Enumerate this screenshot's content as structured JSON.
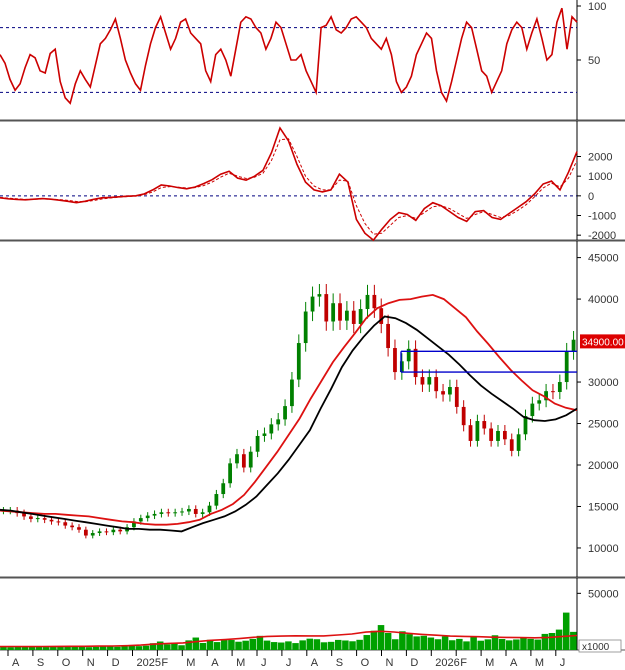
{
  "chart_data": {
    "type": "stock-chart",
    "colors": {
      "up": "#008000",
      "down": "#c00000",
      "indicator": "#cc0000",
      "ma_short": "#000000",
      "ma_long": "#dd1111",
      "box": "#0000cc",
      "guide": "#000080",
      "price_tag": "#dd0000",
      "volume": "#00a000"
    },
    "x_axis": {
      "labels": [
        "A",
        "S",
        "O",
        "N",
        "D",
        "2025",
        "F",
        "M",
        "A",
        "M",
        "J",
        "J",
        "A",
        "S",
        "O",
        "N",
        "D",
        "2026",
        "F",
        "M",
        "A",
        "M",
        "J"
      ]
    },
    "panels": {
      "oscillator": {
        "ylim": [
          0,
          100
        ],
        "ticks": [
          {
            "v": 100,
            "label": "100"
          },
          {
            "v": 50,
            "label": "50"
          }
        ],
        "guide_lines": [
          80,
          20
        ],
        "series": [
          55,
          47,
          32,
          22,
          28,
          43,
          55,
          52,
          40,
          38,
          56,
          60,
          30,
          15,
          10,
          28,
          40,
          32,
          25,
          45,
          65,
          70,
          78,
          88,
          70,
          50,
          38,
          28,
          22,
          45,
          65,
          80,
          90,
          75,
          60,
          70,
          85,
          88,
          75,
          70,
          65,
          40,
          30,
          55,
          60,
          50,
          35,
          60,
          85,
          90,
          88,
          80,
          75,
          60,
          70,
          85,
          80,
          65,
          50,
          50,
          55,
          40,
          30,
          20,
          80,
          82,
          90,
          78,
          75,
          80,
          88,
          90,
          85,
          80,
          70,
          65,
          60,
          70,
          55,
          30,
          20,
          25,
          35,
          55,
          65,
          75,
          70,
          40,
          20,
          12,
          30,
          50,
          70,
          85,
          80,
          60,
          40,
          35,
          20,
          30,
          40,
          65,
          78,
          85,
          80,
          60,
          75,
          88,
          70,
          50,
          55,
          85,
          98,
          60,
          90,
          85
        ]
      },
      "macd": {
        "ylim": [
          -2500,
          3500
        ],
        "ticks": [
          {
            "v": 2000,
            "label": "2000"
          },
          {
            "v": 1000,
            "label": "1000"
          },
          {
            "v": 0,
            "label": "0"
          },
          {
            "v": -1000,
            "label": "-1000"
          },
          {
            "v": -2000,
            "label": "-2000"
          }
        ],
        "zero_line": 0,
        "macd": [
          -100,
          -150,
          -180,
          -200,
          -170,
          -140,
          -170,
          -220,
          -280,
          -350,
          -280,
          -180,
          -100,
          -80,
          -50,
          -20,
          0,
          100,
          300,
          550,
          500,
          420,
          360,
          450,
          620,
          820,
          1100,
          1250,
          900,
          800,
          1000,
          1300,
          2200,
          3450,
          2800,
          1600,
          700,
          300,
          200,
          300,
          1100,
          700,
          -1200,
          -1900,
          -2250,
          -1700,
          -1200,
          -850,
          -950,
          -1250,
          -650,
          -350,
          -500,
          -800,
          -1100,
          -1300,
          -800,
          -750,
          -1100,
          -1200,
          -900,
          -600,
          -300,
          100,
          600,
          750,
          300,
          1200,
          2250
        ],
        "signal": [
          -80,
          -120,
          -150,
          -180,
          -175,
          -160,
          -165,
          -190,
          -230,
          -290,
          -300,
          -240,
          -160,
          -110,
          -70,
          -40,
          -15,
          60,
          200,
          420,
          470,
          440,
          400,
          420,
          520,
          700,
          950,
          1150,
          1000,
          880,
          950,
          1150,
          1800,
          2850,
          2900,
          2000,
          1000,
          500,
          300,
          300,
          800,
          750,
          -500,
          -1400,
          -1950,
          -1900,
          -1500,
          -1100,
          -1000,
          -1150,
          -850,
          -550,
          -500,
          -650,
          -900,
          -1150,
          -950,
          -800,
          -950,
          -1100,
          -1000,
          -750,
          -450,
          -50,
          400,
          650,
          450,
          900,
          1800
        ]
      },
      "price": {
        "ylim": [
          6500,
          47000
        ],
        "ticks": [
          {
            "v": 45000,
            "label": "45000"
          },
          {
            "v": 40000,
            "label": "40000"
          },
          {
            "v": 30000,
            "label": "30000"
          },
          {
            "v": 25000,
            "label": "25000"
          },
          {
            "v": 20000,
            "label": "20000"
          },
          {
            "v": 15000,
            "label": "15000"
          },
          {
            "v": 10000,
            "label": "10000"
          }
        ],
        "last_price_label": "34900.00",
        "last_price": 34900,
        "close": [
          14500,
          14500,
          14200,
          13800,
          13500,
          13600,
          13400,
          13200,
          13100,
          12700,
          12500,
          12200,
          11500,
          11800,
          12000,
          11900,
          12200,
          12000,
          12500,
          13200,
          13600,
          13900,
          14100,
          14300,
          14200,
          14300,
          14400,
          14700,
          14100,
          14300,
          15100,
          16500,
          17800,
          20200,
          21300,
          19700,
          21600,
          23500,
          23800,
          24900,
          25500,
          27100,
          30300,
          34700,
          38500,
          40300,
          40600,
          37300,
          39500,
          37400,
          38600,
          37000,
          38800,
          40500,
          38900,
          37000,
          34100,
          31200,
          32500,
          34000,
          30600,
          29700,
          30600,
          28900,
          28500,
          29400,
          27000,
          24800,
          22900,
          25300,
          24400,
          22900,
          24100,
          23100,
          21700,
          23700,
          25900,
          27400,
          27800,
          28900,
          28800,
          30000,
          33700,
          35100
        ],
        "ma_short": [
          14600,
          14500,
          14300,
          14100,
          13900,
          13700,
          13500,
          13300,
          13100,
          12900,
          12700,
          12500,
          12300,
          12300,
          12200,
          12200,
          12100,
          12000,
          12500,
          13000,
          13400,
          13800,
          14400,
          15200,
          16200,
          17600,
          19000,
          20600,
          22400,
          24200,
          26800,
          29200,
          31800,
          33800,
          35400,
          36800,
          37900,
          37700,
          37100,
          36300,
          35300,
          34300,
          33300,
          32100,
          30800,
          29600,
          28600,
          27700,
          26800,
          25800,
          25400,
          25300,
          25500,
          26000,
          26800
        ],
        "ma_long": [
          14500,
          14400,
          14300,
          14200,
          14100,
          14100,
          14000,
          13900,
          13800,
          13600,
          13400,
          13200,
          13100,
          12900,
          12800,
          12800,
          12900,
          13100,
          13400,
          14100,
          14600,
          15300,
          16400,
          18000,
          19800,
          21600,
          23600,
          25600,
          28000,
          30200,
          32400,
          34200,
          35900,
          37700,
          38900,
          39500,
          39900,
          40000,
          40300,
          40500,
          40000,
          38900,
          37800,
          36100,
          34600,
          33000,
          31500,
          30200,
          29000,
          28300,
          27400,
          26900,
          26600
        ],
        "box": {
          "y_top": 33700,
          "y_bottom": 31200
        },
        "box2_top": 33700
      },
      "volume": {
        "ylim": [
          0,
          60000
        ],
        "ticks": [
          {
            "v": 50000,
            "label": "50000"
          }
        ],
        "unit_label": "x1000",
        "values": [
          3000,
          2500,
          3200,
          2800,
          3500,
          3000,
          2600,
          2900,
          3100,
          2700,
          3300,
          3000,
          2500,
          2800,
          3200,
          3100,
          2900,
          3300,
          3600,
          3400,
          3800,
          6000,
          7500,
          5000,
          6400,
          4200,
          8500,
          11000,
          6200,
          9000,
          7000,
          9500,
          8800,
          7300,
          8200,
          9800,
          12500,
          8300,
          7000,
          6600,
          7600,
          6100,
          8500,
          10000,
          9500,
          6800,
          7200,
          8900,
          8400,
          7700,
          9000,
          13200,
          17000,
          22000,
          15000,
          9500,
          16500,
          14000,
          12000,
          12500,
          11000,
          9500,
          12000,
          8600,
          9800,
          7600,
          12000,
          8200,
          9400,
          13000,
          9700,
          8500,
          9300,
          10800,
          9800,
          9200,
          14200,
          15000,
          18000,
          33000,
          16000
        ],
        "avg": [
          3000,
          3100,
          3000,
          3100,
          3200,
          3300,
          3300,
          3400,
          3500,
          3800,
          4300,
          5200,
          5800,
          6300,
          7400,
          8600,
          9200,
          10100,
          11200,
          12000,
          12300,
          12500,
          12400,
          12400,
          13200,
          14100,
          15800,
          16500,
          15900,
          14700,
          13800,
          13100,
          12300,
          12000,
          11700,
          11300,
          11100,
          10900,
          10800,
          11100,
          12000,
          12800
        ]
      }
    }
  }
}
